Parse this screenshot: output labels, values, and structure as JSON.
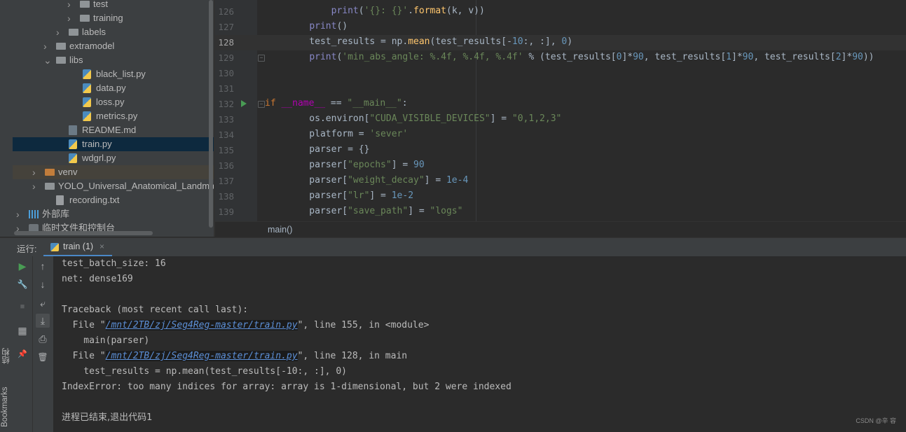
{
  "project_tree": {
    "items": [
      {
        "label": "test",
        "icon": "folder-icon",
        "type": "folder",
        "expandable": true
      },
      {
        "label": "training",
        "icon": "folder-icon",
        "type": "folder",
        "expandable": true
      },
      {
        "label": "labels",
        "icon": "folder-icon",
        "type": "folder",
        "expandable": true
      },
      {
        "label": "extramodel",
        "icon": "folder-icon",
        "type": "folder",
        "expandable": true
      },
      {
        "label": "libs",
        "icon": "folder-icon",
        "type": "folder",
        "expandable": true,
        "expanded": true
      },
      {
        "label": "black_list.py",
        "icon": "python-file-icon",
        "type": "py"
      },
      {
        "label": "data.py",
        "icon": "python-file-icon",
        "type": "py"
      },
      {
        "label": "loss.py",
        "icon": "python-file-icon",
        "type": "py"
      },
      {
        "label": "metrics.py",
        "icon": "python-file-icon",
        "type": "py"
      },
      {
        "label": "README.md",
        "icon": "markdown-file-icon",
        "type": "md"
      },
      {
        "label": "train.py",
        "icon": "python-file-icon",
        "type": "py",
        "selected": true
      },
      {
        "label": "wdgrl.py",
        "icon": "python-file-icon",
        "type": "py"
      },
      {
        "label": "venv",
        "icon": "folder-orange-icon",
        "type": "folder",
        "expandable": true
      },
      {
        "label": "YOLO_Universal_Anatomical_Landmark_",
        "icon": "folder-icon",
        "type": "folder",
        "expandable": true
      },
      {
        "label": "recording.txt",
        "icon": "text-file-icon",
        "type": "txt"
      },
      {
        "label": "外部库",
        "icon": "library-icon",
        "type": "lib",
        "expandable": true
      },
      {
        "label": "临时文件和控制台",
        "icon": "console-icon",
        "type": "console",
        "expandable": true
      }
    ]
  },
  "editor": {
    "current_line": 128,
    "lines": [
      {
        "num": "126",
        "html": "        <span class=\"bf\">print</span>(<span class=\"s\">'{}: {}'</span>.<span class=\"fm\">format</span>(k, v))"
      },
      {
        "num": "127",
        "html": "    <span class=\"bf\">print</span>()"
      },
      {
        "num": "128",
        "html": "    test_results = np.<span class=\"fm\">mean</span>(test_results[-<span class=\"n\">10</span>:, :], <span class=\"n\">0</span>)"
      },
      {
        "num": "129",
        "html": "    <span class=\"bf\">print</span>(<span class=\"s\">'min_abs_angle: %.4f, %.4f, %.4f'</span> % (test_results[<span class=\"n\">0</span>]*<span class=\"n\">90</span>, test_results[<span class=\"n\">1</span>]*<span class=\"n\">90</span>, test_results[<span class=\"n\">2</span>]*<span class=\"n\">90</span>))"
      },
      {
        "num": "130",
        "html": ""
      },
      {
        "num": "131",
        "html": ""
      },
      {
        "num": "132",
        "html": "<span class=\"k\">if</span> <span class=\"dunder\">__name__</span> == <span class=\"s\">\"__main__\"</span>:"
      },
      {
        "num": "133",
        "html": "    os.environ[<span class=\"s\">\"CUDA_VISIBLE_DEVICES\"</span>] = <span class=\"s\">\"0,1,2,3\"</span>"
      },
      {
        "num": "134",
        "html": "    platform = <span class=\"s\">'sever'</span>"
      },
      {
        "num": "135",
        "html": "    parser = {}"
      },
      {
        "num": "136",
        "html": "    parser[<span class=\"s\">\"epochs\"</span>] = <span class=\"n\">90</span>"
      },
      {
        "num": "137",
        "html": "    parser[<span class=\"s\">\"weight_decay\"</span>] = <span class=\"n\">1e-4</span>"
      },
      {
        "num": "138",
        "html": "    parser[<span class=\"s\">\"lr\"</span>] = <span class=\"n\">1e-2</span>"
      },
      {
        "num": "139",
        "html": "    parser[<span class=\"s\">\"save_path\"</span>] = <span class=\"s\">\"logs\"</span>"
      }
    ],
    "breadcrumb": "main()"
  },
  "run_window": {
    "label": "运行:",
    "tab_label": "train (1)",
    "tab_close": "×",
    "toolbar": [
      {
        "name": "rerun-icon",
        "glyph": "▶"
      },
      {
        "name": "scroll-up-icon",
        "glyph": "↑"
      },
      {
        "name": "wrench-icon",
        "glyph": "🔧"
      },
      {
        "name": "scroll-down-icon",
        "glyph": "↓"
      },
      {
        "name": "stop-icon",
        "glyph": "■"
      },
      {
        "name": "soft-wrap-icon",
        "glyph": "⤶"
      },
      {
        "name": "scroll-to-end-icon",
        "glyph": "⤓"
      },
      {
        "name": "print-icon",
        "glyph": "⎙"
      },
      {
        "name": "layout-icon",
        "glyph": "▦"
      },
      {
        "name": "pin-icon",
        "glyph": "📌"
      },
      {
        "name": "trash-icon",
        "glyph": "🗑"
      }
    ],
    "side_labels": {
      "structure": "结构",
      "bookmarks": "Bookmarks"
    },
    "console": [
      {
        "text": "test_batch_size: 16"
      },
      {
        "text": "net: dense169"
      },
      {
        "text": ""
      },
      {
        "text": "Traceback (most recent call last):"
      },
      {
        "pre": "  File \"",
        "link": "/mnt/2TB/zj/Seg4Reg-master/train.py",
        "post": "\", line 155, in <module>"
      },
      {
        "text": "    main(parser)"
      },
      {
        "pre": "  File \"",
        "link": "/mnt/2TB/zj/Seg4Reg-master/train.py",
        "post": "\", line 128, in main"
      },
      {
        "text": "    test_results = np.mean(test_results[-10:, :], 0)"
      },
      {
        "text": "IndexError: too many indices for array: array is 1-dimensional, but 2 were indexed"
      },
      {
        "text": ""
      },
      {
        "text": "进程已结束,退出代码1",
        "cn": true
      }
    ],
    "watermark": "CSDN @辛 容"
  }
}
